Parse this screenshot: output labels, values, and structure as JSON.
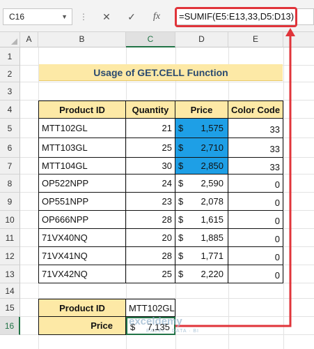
{
  "name_box": "C16",
  "formula_bar": {
    "cancel_glyph": "✕",
    "enter_glyph": "✓",
    "fx_glyph": "fx",
    "formula": "=SUMIF(E5:E13,33,D5:D13)"
  },
  "columns": [
    "A",
    "B",
    "C",
    "D",
    "E"
  ],
  "rows": [
    "1",
    "2",
    "3",
    "4",
    "5",
    "6",
    "7",
    "8",
    "9",
    "10",
    "11",
    "12",
    "13",
    "14",
    "15",
    "16"
  ],
  "title": "Usage of GET.CELL Function",
  "table": {
    "headers": [
      "Product ID",
      "Quantity",
      "Price",
      "Color Code"
    ],
    "rows": [
      {
        "id": "MTT102GL",
        "qty": "21",
        "currency": "$",
        "price": "1,575",
        "code": "33",
        "highlight": true
      },
      {
        "id": "MTT103GL",
        "qty": "25",
        "currency": "$",
        "price": "2,710",
        "code": "33",
        "highlight": true
      },
      {
        "id": "MTT104GL",
        "qty": "30",
        "currency": "$",
        "price": "2,850",
        "code": "33",
        "highlight": true
      },
      {
        "id": "OP522NPP",
        "qty": "24",
        "currency": "$",
        "price": "2,590",
        "code": "0",
        "highlight": false
      },
      {
        "id": "OP551NPP",
        "qty": "23",
        "currency": "$",
        "price": "2,078",
        "code": "0",
        "highlight": false
      },
      {
        "id": "OP666NPP",
        "qty": "28",
        "currency": "$",
        "price": "1,615",
        "code": "0",
        "highlight": false
      },
      {
        "id": "71VX40NQ",
        "qty": "20",
        "currency": "$",
        "price": "1,885",
        "code": "0",
        "highlight": false
      },
      {
        "id": "71VX41NQ",
        "qty": "28",
        "currency": "$",
        "price": "1,771",
        "code": "0",
        "highlight": false
      },
      {
        "id": "71VX42NQ",
        "qty": "25",
        "currency": "$",
        "price": "2,220",
        "code": "0",
        "highlight": false
      }
    ]
  },
  "lookup": {
    "product_label": "Product ID",
    "product_value": "MTT102GL",
    "price_label": "Price",
    "price_currency": "$",
    "price_value": "7,135"
  },
  "watermark": {
    "brand": "exceldemy",
    "tagline": "EXCEL · DATA · BI"
  },
  "colors": {
    "header_fill": "#fde9a6",
    "highlight_fill": "#1e9fe6",
    "arrow": "#e0343a",
    "selection": "#217346"
  }
}
